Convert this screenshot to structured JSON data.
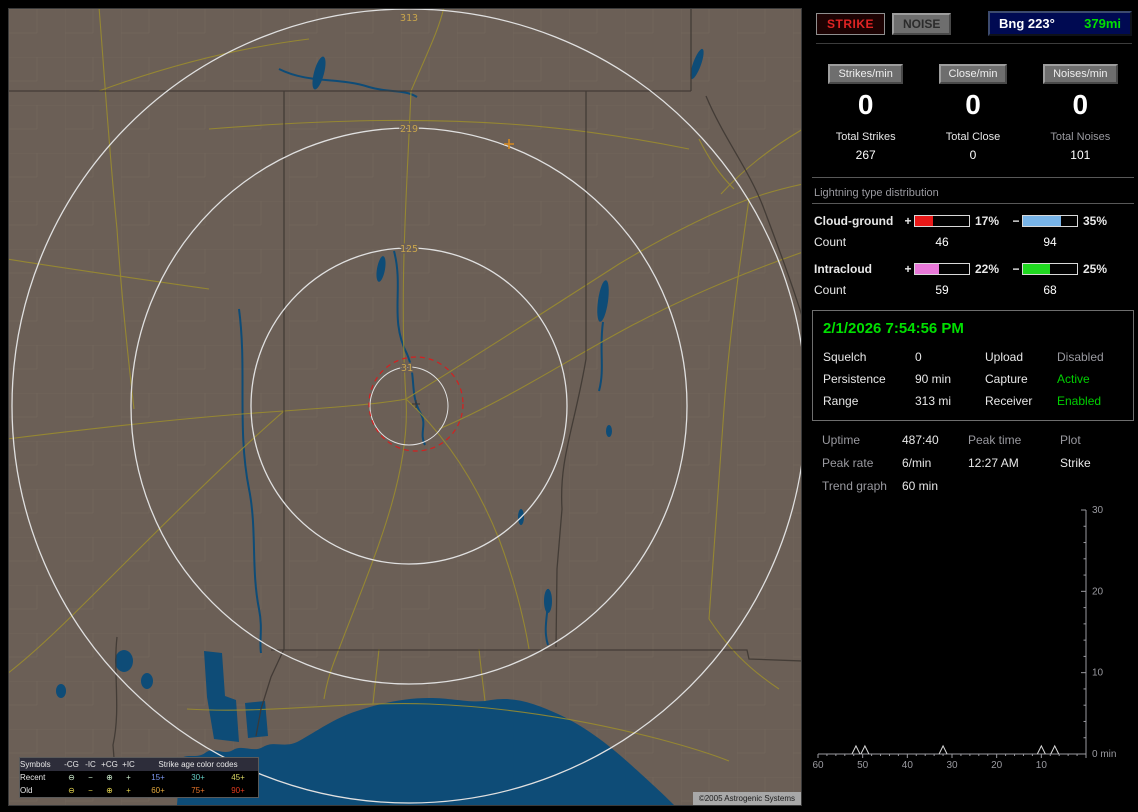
{
  "map": {
    "land_color": "#6b5f56",
    "water_color": "#0e4c77",
    "road_color": "#9d8e2c",
    "ring_label_color": "#c8a44c",
    "ring_labels": [
      "31",
      "125",
      "219",
      "313"
    ],
    "copyright": "©2005 Astrogenic Systems",
    "legend": {
      "symbols_header": "Symbols",
      "columns": [
        "-CG",
        "-IC",
        "+CG",
        "+IC"
      ],
      "age_header": "Strike age color codes",
      "rows": [
        {
          "label": "Recent",
          "symbol_color": "#cdeccd",
          "symbols": [
            "⊖",
            "−",
            "⊕",
            "+"
          ],
          "ages": [
            {
              "text": "15+",
              "color": "#7a95ec"
            },
            {
              "text": "30+",
              "color": "#62c9c0"
            },
            {
              "text": "45+",
              "color": "#d8d664"
            }
          ]
        },
        {
          "label": "Old",
          "symbol_color": "#e3d34e",
          "symbols": [
            "⊖",
            "−",
            "⊕",
            "+"
          ],
          "ages": [
            {
              "text": "60+",
              "color": "#e2a73b"
            },
            {
              "text": "75+",
              "color": "#e4732a"
            },
            {
              "text": "90+",
              "color": "#e33a1e"
            }
          ]
        }
      ]
    }
  },
  "panel": {
    "strike_button": "STRIKE",
    "noise_button": "NOISE",
    "bearing_label": "Bng 223°",
    "bearing_distance": "379mi",
    "counters": [
      {
        "chip": "Strikes/min",
        "rate": "0",
        "total_label": "Total Strikes",
        "total": "267"
      },
      {
        "chip": "Close/min",
        "rate": "0",
        "total_label": "Total Close",
        "total": "0"
      },
      {
        "chip": "Noises/min",
        "rate": "0",
        "total_label": "Total Noises",
        "total": "101"
      }
    ],
    "distribution": {
      "title": "Lightning type distribution",
      "count_label": "Count",
      "plus_sign": "+",
      "minus_sign": "−",
      "rows": [
        {
          "label": "Cloud-ground",
          "pos_pct": "17%",
          "pos_count": "46",
          "pos_color": "#e81818",
          "neg_pct": "35%",
          "neg_count": "94",
          "neg_color": "#78b4e8"
        },
        {
          "label": "Intracloud",
          "pos_pct": "22%",
          "pos_count": "59",
          "pos_color": "#e878d8",
          "neg_pct": "25%",
          "neg_count": "68",
          "neg_color": "#20d820"
        }
      ]
    },
    "status": {
      "datetime": "2/1/2026 7:54:56 PM",
      "rows": [
        {
          "l1": "Squelch",
          "v1": "0",
          "l2": "Upload",
          "v2": "Disabled",
          "v2_color": "#9a9aa0"
        },
        {
          "l1": "Persistence",
          "v1": "90 min",
          "l2": "Capture",
          "v2": "Active",
          "v2_color": "#00d000"
        },
        {
          "l1": "Range",
          "v1": "313 mi",
          "l2": "Receiver",
          "v2": "Enabled",
          "v2_color": "#00d000"
        }
      ]
    },
    "stats": {
      "uptime_label": "Uptime",
      "uptime": "487:40",
      "peak_time_label": "Peak time",
      "plot_label": "Plot",
      "peak_rate_label": "Peak rate",
      "peak_rate": "6/min",
      "peak_time": "12:27 AM",
      "plot": "Strike",
      "trend_label": "Trend graph",
      "trend_window": "60 min"
    }
  },
  "chart_data": {
    "type": "line",
    "title": "Trend graph - strikes per minute over last 60 minutes",
    "x_unit": "min",
    "x_ticks": [
      60,
      50,
      40,
      30,
      20,
      10,
      0
    ],
    "y_ticks": [
      0,
      10,
      20,
      30
    ],
    "xlim_minutes_ago": [
      60,
      0
    ],
    "ylim": [
      0,
      30
    ],
    "zero_label": "0 min",
    "points": [
      {
        "min_ago": 51.5,
        "value": 1
      },
      {
        "min_ago": 49.5,
        "value": 1
      },
      {
        "min_ago": 32,
        "value": 1
      },
      {
        "min_ago": 10,
        "value": 1
      },
      {
        "min_ago": 7,
        "value": 1
      }
    ]
  }
}
